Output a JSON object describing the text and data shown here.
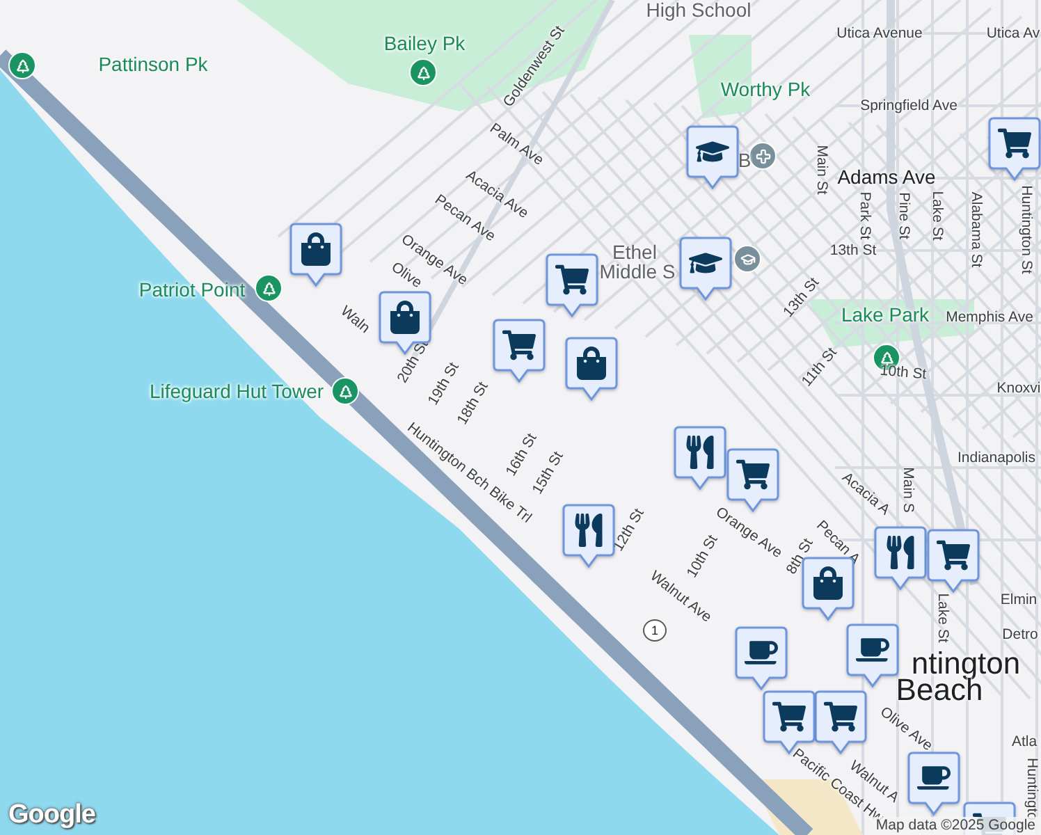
{
  "map": {
    "labels": [
      {
        "text": "High School",
        "kind": "place"
      },
      {
        "text": "Utica Avenue",
        "kind": "street"
      },
      {
        "text": "Utica Av",
        "kind": "street"
      },
      {
        "text": "Bailey Pk",
        "kind": "park"
      },
      {
        "text": "Pattinson Pk",
        "kind": "park"
      },
      {
        "text": "Goldenwest St",
        "kind": "street"
      },
      {
        "text": "Worthy Pk",
        "kind": "park"
      },
      {
        "text": "Springfield Ave",
        "kind": "street"
      },
      {
        "text": "Palm Ave",
        "kind": "street"
      },
      {
        "text": "B",
        "kind": "place"
      },
      {
        "text": "Main St",
        "kind": "street"
      },
      {
        "text": "Adams Ave",
        "kind": "major"
      },
      {
        "text": "Acacia Ave",
        "kind": "street"
      },
      {
        "text": "Park St",
        "kind": "street"
      },
      {
        "text": "Pine St",
        "kind": "street"
      },
      {
        "text": "Lake St",
        "kind": "street"
      },
      {
        "text": "Pecan Ave",
        "kind": "street"
      },
      {
        "text": "Alabama St",
        "kind": "street"
      },
      {
        "text": "Huntington St",
        "kind": "street"
      },
      {
        "text": "13th St",
        "kind": "street"
      },
      {
        "text": "Ethel",
        "kind": "place"
      },
      {
        "text": "Orange Ave",
        "kind": "street"
      },
      {
        "text": "Middle S",
        "kind": "place"
      },
      {
        "text": "Olive",
        "kind": "street"
      },
      {
        "text": "Patriot Point",
        "kind": "park"
      },
      {
        "text": "13th St",
        "kind": "street"
      },
      {
        "text": "Lake Park",
        "kind": "park"
      },
      {
        "text": "Memphis Ave",
        "kind": "street"
      },
      {
        "text": "Waln",
        "kind": "street"
      },
      {
        "text": "20th St",
        "kind": "street"
      },
      {
        "text": "11th St",
        "kind": "street"
      },
      {
        "text": "10th St",
        "kind": "street"
      },
      {
        "text": "19th St",
        "kind": "street"
      },
      {
        "text": "Knoxvi",
        "kind": "street"
      },
      {
        "text": "Lifeguard Hut Tower",
        "kind": "park"
      },
      {
        "text": "18th St",
        "kind": "street"
      },
      {
        "text": "16th St",
        "kind": "street"
      },
      {
        "text": "Indianapolis",
        "kind": "street"
      },
      {
        "text": "Huntington Bch Bike Trl",
        "kind": "street"
      },
      {
        "text": "15th St",
        "kind": "street"
      },
      {
        "text": "Main S",
        "kind": "street"
      },
      {
        "text": "Acacia A",
        "kind": "street"
      },
      {
        "text": "12th St",
        "kind": "street"
      },
      {
        "text": "Orange Ave",
        "kind": "street"
      },
      {
        "text": "Pecan A",
        "kind": "street"
      },
      {
        "text": "8th St",
        "kind": "street"
      },
      {
        "text": "10th St",
        "kind": "street"
      },
      {
        "text": "Walnut Ave",
        "kind": "street"
      },
      {
        "text": "Elmin",
        "kind": "street"
      },
      {
        "text": "Lake St",
        "kind": "street"
      },
      {
        "text": "Detro",
        "kind": "street"
      },
      {
        "text": "ntington",
        "kind": "city"
      },
      {
        "text": "Beach",
        "kind": "city"
      },
      {
        "text": "Olive Ave",
        "kind": "street"
      },
      {
        "text": "Atla",
        "kind": "street"
      },
      {
        "text": "Walnut A",
        "kind": "street"
      },
      {
        "text": "Pacific Coast Hw",
        "kind": "street"
      },
      {
        "text": "Huntingto",
        "kind": "street"
      }
    ],
    "route_shield": "1",
    "poi_icons": [
      {
        "kind": "park"
      },
      {
        "kind": "park"
      },
      {
        "kind": "park"
      },
      {
        "kind": "park"
      },
      {
        "kind": "park"
      },
      {
        "kind": "church"
      },
      {
        "kind": "school"
      }
    ],
    "markers": [
      {
        "kind": "grocery"
      },
      {
        "kind": "school"
      },
      {
        "kind": "shopping"
      },
      {
        "kind": "school"
      },
      {
        "kind": "grocery"
      },
      {
        "kind": "shopping"
      },
      {
        "kind": "grocery"
      },
      {
        "kind": "shopping"
      },
      {
        "kind": "restaurant"
      },
      {
        "kind": "grocery"
      },
      {
        "kind": "restaurant"
      },
      {
        "kind": "restaurant"
      },
      {
        "kind": "grocery"
      },
      {
        "kind": "shopping"
      },
      {
        "kind": "cafe"
      },
      {
        "kind": "cafe"
      },
      {
        "kind": "grocery"
      },
      {
        "kind": "grocery"
      },
      {
        "kind": "cafe"
      },
      {
        "kind": "grocery"
      }
    ],
    "attribution": "Map data ©2025 Google",
    "logo": "Google"
  }
}
